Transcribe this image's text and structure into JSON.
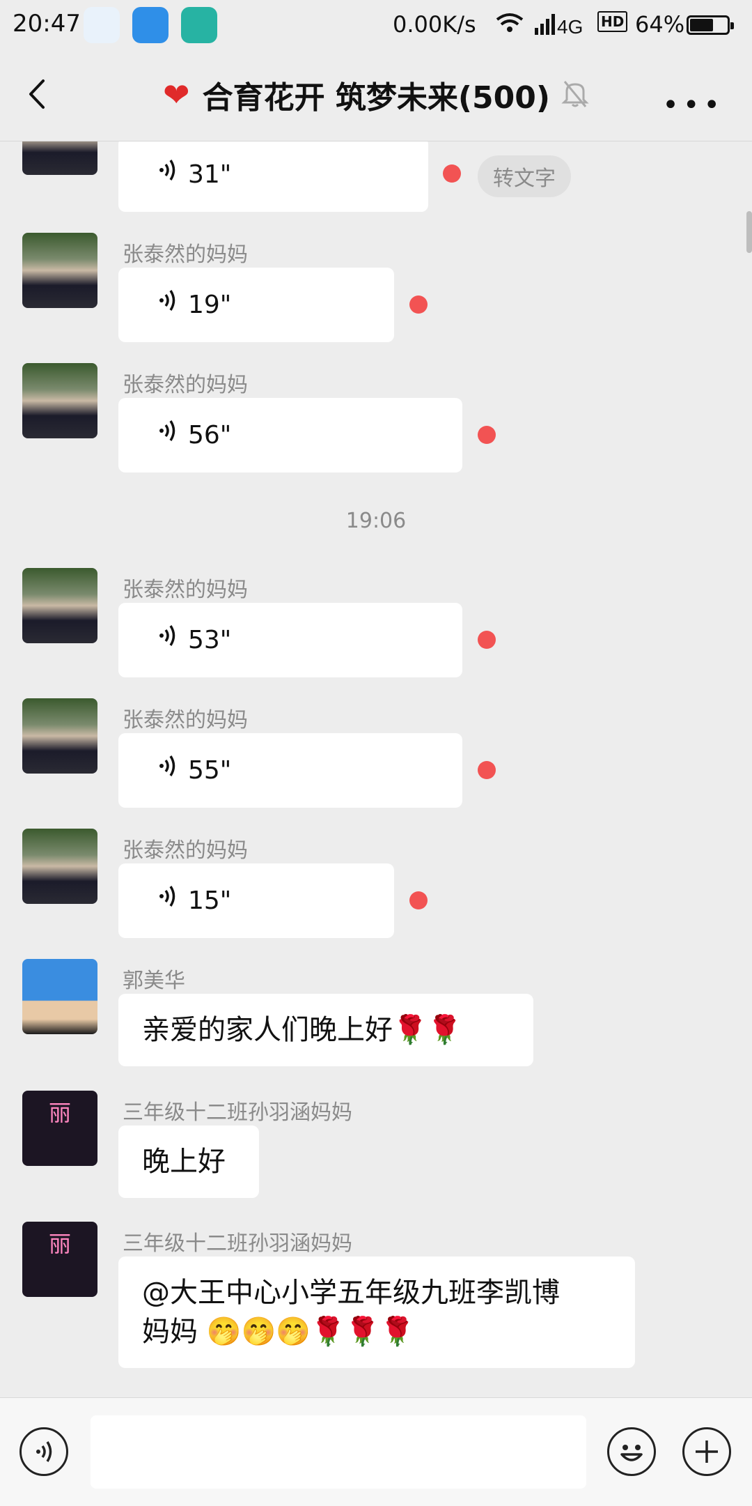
{
  "status_bar": {
    "time": "20:47",
    "net_speed": "0.00K/s",
    "network": "4G",
    "battery_text": "64%",
    "battery_level": 0.64
  },
  "nav": {
    "title": "合育花开 筑梦未来(500)"
  },
  "chat": {
    "messages": [
      {
        "duration": "31\"",
        "convert_label": "转文字"
      },
      {
        "sender": "张泰然的妈妈",
        "duration": "19\""
      },
      {
        "sender": "张泰然的妈妈",
        "duration": "56\""
      },
      {
        "timestamp": "19:06"
      },
      {
        "sender": "张泰然的妈妈",
        "duration": "53\""
      },
      {
        "sender": "张泰然的妈妈",
        "duration": "55\""
      },
      {
        "sender": "张泰然的妈妈",
        "duration": "15\""
      },
      {
        "sender": "郭美华",
        "text": "亲爱的家人们晚上好🌹🌹"
      },
      {
        "sender": "三年级十二班孙羽涵妈妈",
        "text": "晚上好",
        "avatar_text": "丽"
      },
      {
        "sender": "三年级十二班孙羽涵妈妈",
        "text_line1": "@大王中心小学五年级九班李凯博",
        "text_line2": "妈妈 🤭🤭🤭🌹🌹🌹",
        "avatar_text": "丽"
      }
    ]
  },
  "colors": {
    "background": "#ededed",
    "bubble": "#ffffff",
    "unread_dot": "#f25353",
    "name_text": "#8a8a8a"
  }
}
